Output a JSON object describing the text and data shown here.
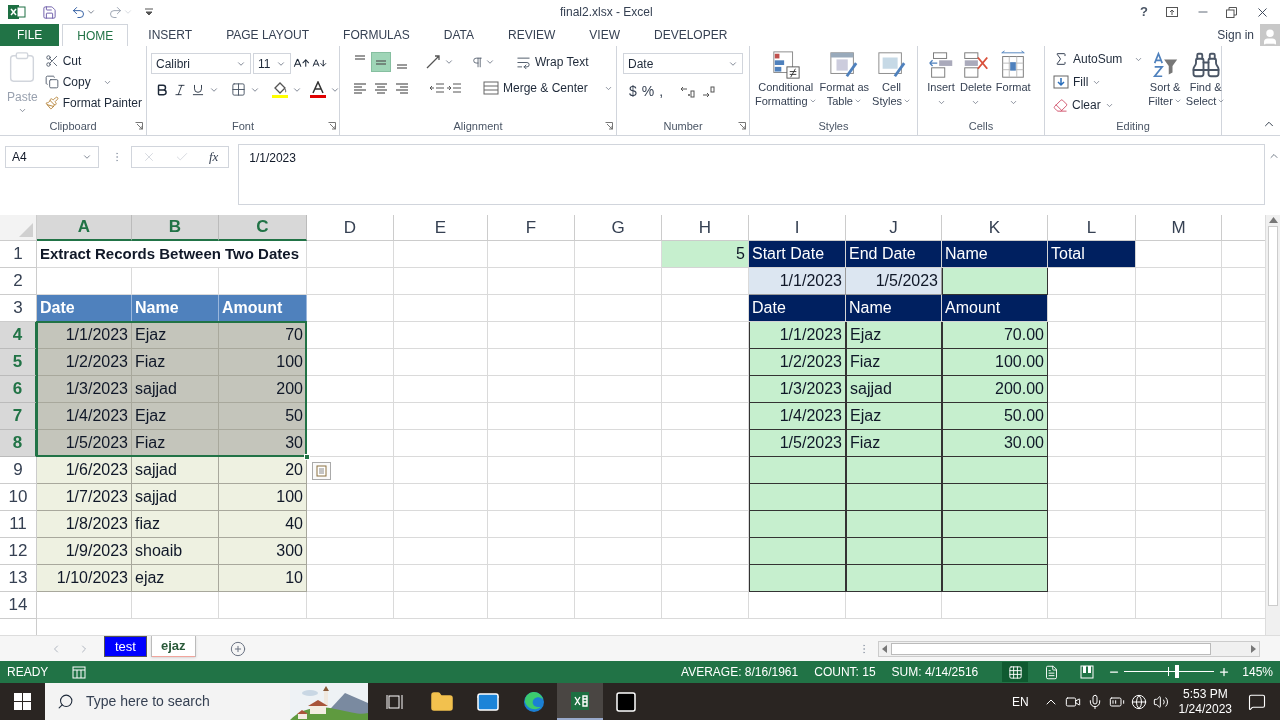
{
  "title_bar": {
    "title": "final2.xlsx - Excel",
    "help": "?"
  },
  "ribbon_tabs": [
    {
      "label": "FILE",
      "kind": "file",
      "selected": false
    },
    {
      "label": "HOME",
      "kind": "tab",
      "selected": true
    },
    {
      "label": "INSERT",
      "kind": "tab",
      "selected": false
    },
    {
      "label": "PAGE LAYOUT",
      "kind": "tab",
      "selected": false
    },
    {
      "label": "FORMULAS",
      "kind": "tab",
      "selected": false
    },
    {
      "label": "DATA",
      "kind": "tab",
      "selected": false
    },
    {
      "label": "REVIEW",
      "kind": "tab",
      "selected": false
    },
    {
      "label": "VIEW",
      "kind": "tab",
      "selected": false
    },
    {
      "label": "DEVELOPER",
      "kind": "tab",
      "selected": false
    }
  ],
  "account": {
    "label": "Sign in"
  },
  "ribbon": {
    "clipboard": {
      "label": "Clipboard",
      "paste": {
        "label": "Paste",
        "disabled": true
      },
      "cut": "Cut",
      "copy": "Copy",
      "format_painter": "Format Painter"
    },
    "font": {
      "label": "Font",
      "name": "Calibri",
      "size": "11"
    },
    "alignment": {
      "label": "Alignment",
      "vertical": [
        {
          "selected": false
        },
        {
          "selected": true
        },
        {
          "selected": false
        }
      ],
      "wrap_text": "Wrap Text",
      "merge": "Merge & Center"
    },
    "number": {
      "label": "Number",
      "format": "Date",
      "symbols": [
        "$",
        "%",
        ","
      ]
    },
    "styles": {
      "label": "Styles",
      "buttons": [
        {
          "kind": "conditional",
          "lines": [
            "Conditional",
            "Formatting"
          ]
        },
        {
          "kind": "table",
          "lines": [
            "Format as",
            "Table"
          ]
        },
        {
          "kind": "cell_styles",
          "lines": [
            "Cell",
            "Styles"
          ]
        }
      ]
    },
    "cells": {
      "label": "Cells",
      "buttons": [
        {
          "kind": "insert",
          "label": "Insert"
        },
        {
          "kind": "delete",
          "label": "Delete"
        },
        {
          "kind": "format",
          "label": "Format"
        }
      ]
    },
    "editing": {
      "label": "Editing",
      "autosum": "AutoSum",
      "fill": "Fill",
      "clear": "Clear",
      "sort": [
        "Sort &",
        "Filter"
      ],
      "find": [
        "Find &",
        "Select"
      ]
    }
  },
  "formula_bar": {
    "name_box": "A4",
    "function_label": "fx",
    "formula": "1/1/2023"
  },
  "sheet": {
    "columns": [
      {
        "label": "A",
        "selected": true
      },
      {
        "label": "B",
        "selected": true
      },
      {
        "label": "C",
        "selected": true
      },
      {
        "label": "D",
        "selected": false
      },
      {
        "label": "E",
        "selected": false
      },
      {
        "label": "F",
        "selected": false
      },
      {
        "label": "G",
        "selected": false
      },
      {
        "label": "H",
        "selected": false
      },
      {
        "label": "I",
        "selected": false
      },
      {
        "label": "J",
        "selected": false
      },
      {
        "label": "K",
        "selected": false
      },
      {
        "label": "L",
        "selected": false
      },
      {
        "label": "M",
        "selected": false
      }
    ],
    "rows": [
      {
        "number": "1",
        "selected": false,
        "cells": [
          {
            "text": "Extract Records Between Two Dates",
            "kind": "title"
          },
          null,
          null,
          null,
          null,
          null,
          null,
          {
            "text": "5",
            "kind": "green_num"
          },
          {
            "text": "Start Date",
            "kind": "navy"
          },
          {
            "text": "End Date",
            "kind": "navy"
          },
          {
            "text": "Name",
            "kind": "navy"
          },
          {
            "text": "Total",
            "kind": "navy"
          }
        ]
      },
      {
        "number": "2",
        "selected": false,
        "cells": [
          null,
          null,
          null,
          null,
          null,
          null,
          null,
          null,
          {
            "text": "1/1/2023",
            "kind": "input_num"
          },
          {
            "text": "1/5/2023",
            "kind": "input_num"
          },
          {
            "kind": "list_text"
          }
        ]
      },
      {
        "number": "3",
        "selected": false,
        "cells": [
          {
            "text": "Date",
            "kind": "blue"
          },
          {
            "text": "Name",
            "kind": "blue"
          },
          {
            "text": "Amount",
            "kind": "blue"
          },
          null,
          null,
          null,
          null,
          null,
          {
            "text": "Date",
            "kind": "navy"
          },
          {
            "text": "Name",
            "kind": "navy"
          },
          {
            "text": "Amount",
            "kind": "navy"
          }
        ]
      },
      {
        "number": "4",
        "selected": true,
        "cells": [
          {
            "text": "1/1/2023",
            "kind": "band_num"
          },
          {
            "text": "Ejaz",
            "kind": "band_text"
          },
          {
            "text": "70",
            "kind": "band_num"
          },
          null,
          null,
          null,
          null,
          null,
          {
            "text": "1/1/2023",
            "kind": "list_num"
          },
          {
            "text": "Ejaz",
            "kind": "list_text"
          },
          {
            "text": "70.00",
            "kind": "list_num"
          }
        ]
      },
      {
        "number": "5",
        "selected": true,
        "cells": [
          {
            "text": "1/2/2023",
            "kind": "band_num"
          },
          {
            "text": "Fiaz",
            "kind": "band_text"
          },
          {
            "text": "100",
            "kind": "band_num"
          },
          null,
          null,
          null,
          null,
          null,
          {
            "text": "1/2/2023",
            "kind": "list_num"
          },
          {
            "text": "Fiaz",
            "kind": "list_text"
          },
          {
            "text": "100.00",
            "kind": "list_num"
          }
        ]
      },
      {
        "number": "6",
        "selected": true,
        "cells": [
          {
            "text": "1/3/2023",
            "kind": "band_num"
          },
          {
            "text": "sajjad",
            "kind": "band_text"
          },
          {
            "text": "200",
            "kind": "band_num"
          },
          null,
          null,
          null,
          null,
          null,
          {
            "text": "1/3/2023",
            "kind": "list_num"
          },
          {
            "text": "sajjad",
            "kind": "list_text"
          },
          {
            "text": "200.00",
            "kind": "list_num"
          }
        ]
      },
      {
        "number": "7",
        "selected": true,
        "cells": [
          {
            "text": "1/4/2023",
            "kind": "band_num"
          },
          {
            "text": "Ejaz",
            "kind": "band_text"
          },
          {
            "text": "50",
            "kind": "band_num"
          },
          null,
          null,
          null,
          null,
          null,
          {
            "text": "1/4/2023",
            "kind": "list_num"
          },
          {
            "text": "Ejaz",
            "kind": "list_text"
          },
          {
            "text": "50.00",
            "kind": "list_num"
          }
        ]
      },
      {
        "number": "8",
        "selected": true,
        "cells": [
          {
            "text": "1/5/2023",
            "kind": "band_num"
          },
          {
            "text": "Fiaz",
            "kind": "band_text"
          },
          {
            "text": "30",
            "kind": "band_num"
          },
          null,
          null,
          null,
          null,
          null,
          {
            "text": "1/5/2023",
            "kind": "list_num"
          },
          {
            "text": "Fiaz",
            "kind": "list_text"
          },
          {
            "text": "30.00",
            "kind": "list_num"
          }
        ]
      },
      {
        "number": "9",
        "selected": false,
        "cells": [
          {
            "text": "1/6/2023",
            "kind": "band_num"
          },
          {
            "text": "sajjad",
            "kind": "band_text"
          },
          {
            "text": "20",
            "kind": "band_num"
          },
          null,
          null,
          null,
          null,
          null,
          {
            "kind": "list_num"
          },
          {
            "kind": "list_text"
          },
          {
            "kind": "list_num"
          }
        ]
      },
      {
        "number": "10",
        "selected": false,
        "cells": [
          {
            "text": "1/7/2023",
            "kind": "band_num"
          },
          {
            "text": "sajjad",
            "kind": "band_text"
          },
          {
            "text": "100",
            "kind": "band_num"
          },
          null,
          null,
          null,
          null,
          null,
          {
            "kind": "list_num"
          },
          {
            "kind": "list_text"
          },
          {
            "kind": "list_num"
          }
        ]
      },
      {
        "number": "11",
        "selected": false,
        "cells": [
          {
            "text": "1/8/2023",
            "kind": "band_num"
          },
          {
            "text": "fiaz",
            "kind": "band_text"
          },
          {
            "text": "40",
            "kind": "band_num"
          },
          null,
          null,
          null,
          null,
          null,
          {
            "kind": "list_num"
          },
          {
            "kind": "list_text"
          },
          {
            "kind": "list_num"
          }
        ]
      },
      {
        "number": "12",
        "selected": false,
        "cells": [
          {
            "text": "1/9/2023",
            "kind": "band_num"
          },
          {
            "text": "shoaib",
            "kind": "band_text"
          },
          {
            "text": "300",
            "kind": "band_num"
          },
          null,
          null,
          null,
          null,
          null,
          {
            "kind": "list_num"
          },
          {
            "kind": "list_text"
          },
          {
            "kind": "list_num"
          }
        ]
      },
      {
        "number": "13",
        "selected": false,
        "cells": [
          {
            "text": "1/10/2023",
            "kind": "band_num"
          },
          {
            "text": "ejaz",
            "kind": "band_text"
          },
          {
            "text": "10",
            "kind": "band_num"
          },
          null,
          null,
          null,
          null,
          null,
          {
            "kind": "list_num"
          },
          {
            "kind": "list_text"
          },
          {
            "kind": "list_num"
          }
        ]
      },
      {
        "number": "14",
        "selected": false,
        "cells": []
      }
    ]
  },
  "sheet_tabs": [
    {
      "label": "test",
      "color": "#0000ff",
      "selected": false
    },
    {
      "label": "ejaz",
      "color": "#f2a59c",
      "selected": true
    }
  ],
  "status_bar": {
    "mode": "READY",
    "stats": [
      "AVERAGE: 8/16/1961",
      "COUNT: 15",
      "SUM: 4/14/2516"
    ],
    "views": [
      {
        "kind": "normal",
        "selected": true
      },
      {
        "kind": "page_layout",
        "selected": false
      },
      {
        "kind": "page_break",
        "selected": false
      }
    ],
    "zoom": {
      "level": 0.59,
      "label": "145%"
    }
  },
  "taskbar": {
    "search": {
      "placeholder": "Type here to search"
    },
    "apps": [
      {
        "kind": "task_view",
        "selected": false
      },
      {
        "kind": "explorer",
        "selected": false
      },
      {
        "kind": "mail",
        "selected": false
      },
      {
        "kind": "edge",
        "selected": false
      },
      {
        "kind": "excel",
        "selected": true
      },
      {
        "kind": "terminal",
        "selected": false
      }
    ],
    "language": "EN",
    "time": "5:53 PM",
    "date": "1/24/2023"
  }
}
